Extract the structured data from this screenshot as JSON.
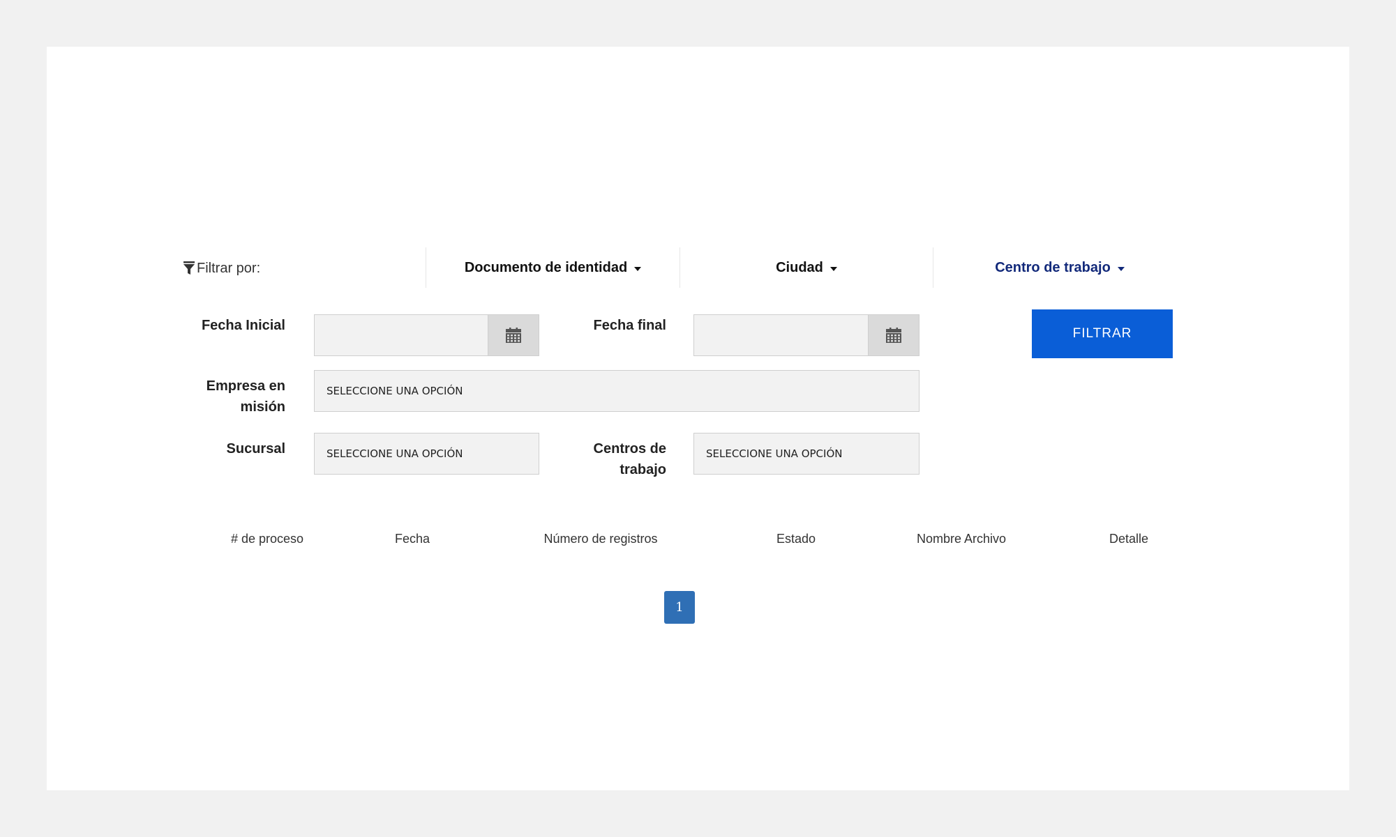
{
  "filter_bar": {
    "label": "Filtrar por:",
    "tabs": [
      {
        "label": "Documento de identidad",
        "active": false
      },
      {
        "label": "Ciudad",
        "active": false
      },
      {
        "label": "Centro de trabajo",
        "active": true
      }
    ],
    "active_color": "#12297a"
  },
  "form": {
    "fecha_inicial_label": "Fecha Inicial",
    "fecha_inicial_value": "",
    "fecha_final_label": "Fecha final",
    "fecha_final_value": "",
    "empresa_label_line1": "Empresa en",
    "empresa_label_line2": "misión",
    "empresa_value": "SELECCIONE UNA OPCIÓN",
    "sucursal_label": "Sucursal",
    "sucursal_value": "SELECCIONE UNA OPCIÓN",
    "centros_label_line1": "Centros de",
    "centros_label_line2": "trabajo",
    "centros_value": "SELECCIONE UNA OPCIÓN",
    "filter_button_label": "FILTRAR",
    "filter_button_color": "#0a5ed7"
  },
  "table": {
    "headers": [
      "# de proceso",
      "Fecha",
      "Número de registros",
      "Estado",
      "Nombre Archivo",
      "Detalle"
    ]
  },
  "pagination": {
    "current_page": "1",
    "color": "#2f6fb5"
  },
  "icons": {
    "filter": "funnel-icon",
    "caret": "caret-down-icon",
    "calendar": "calendar-icon"
  }
}
